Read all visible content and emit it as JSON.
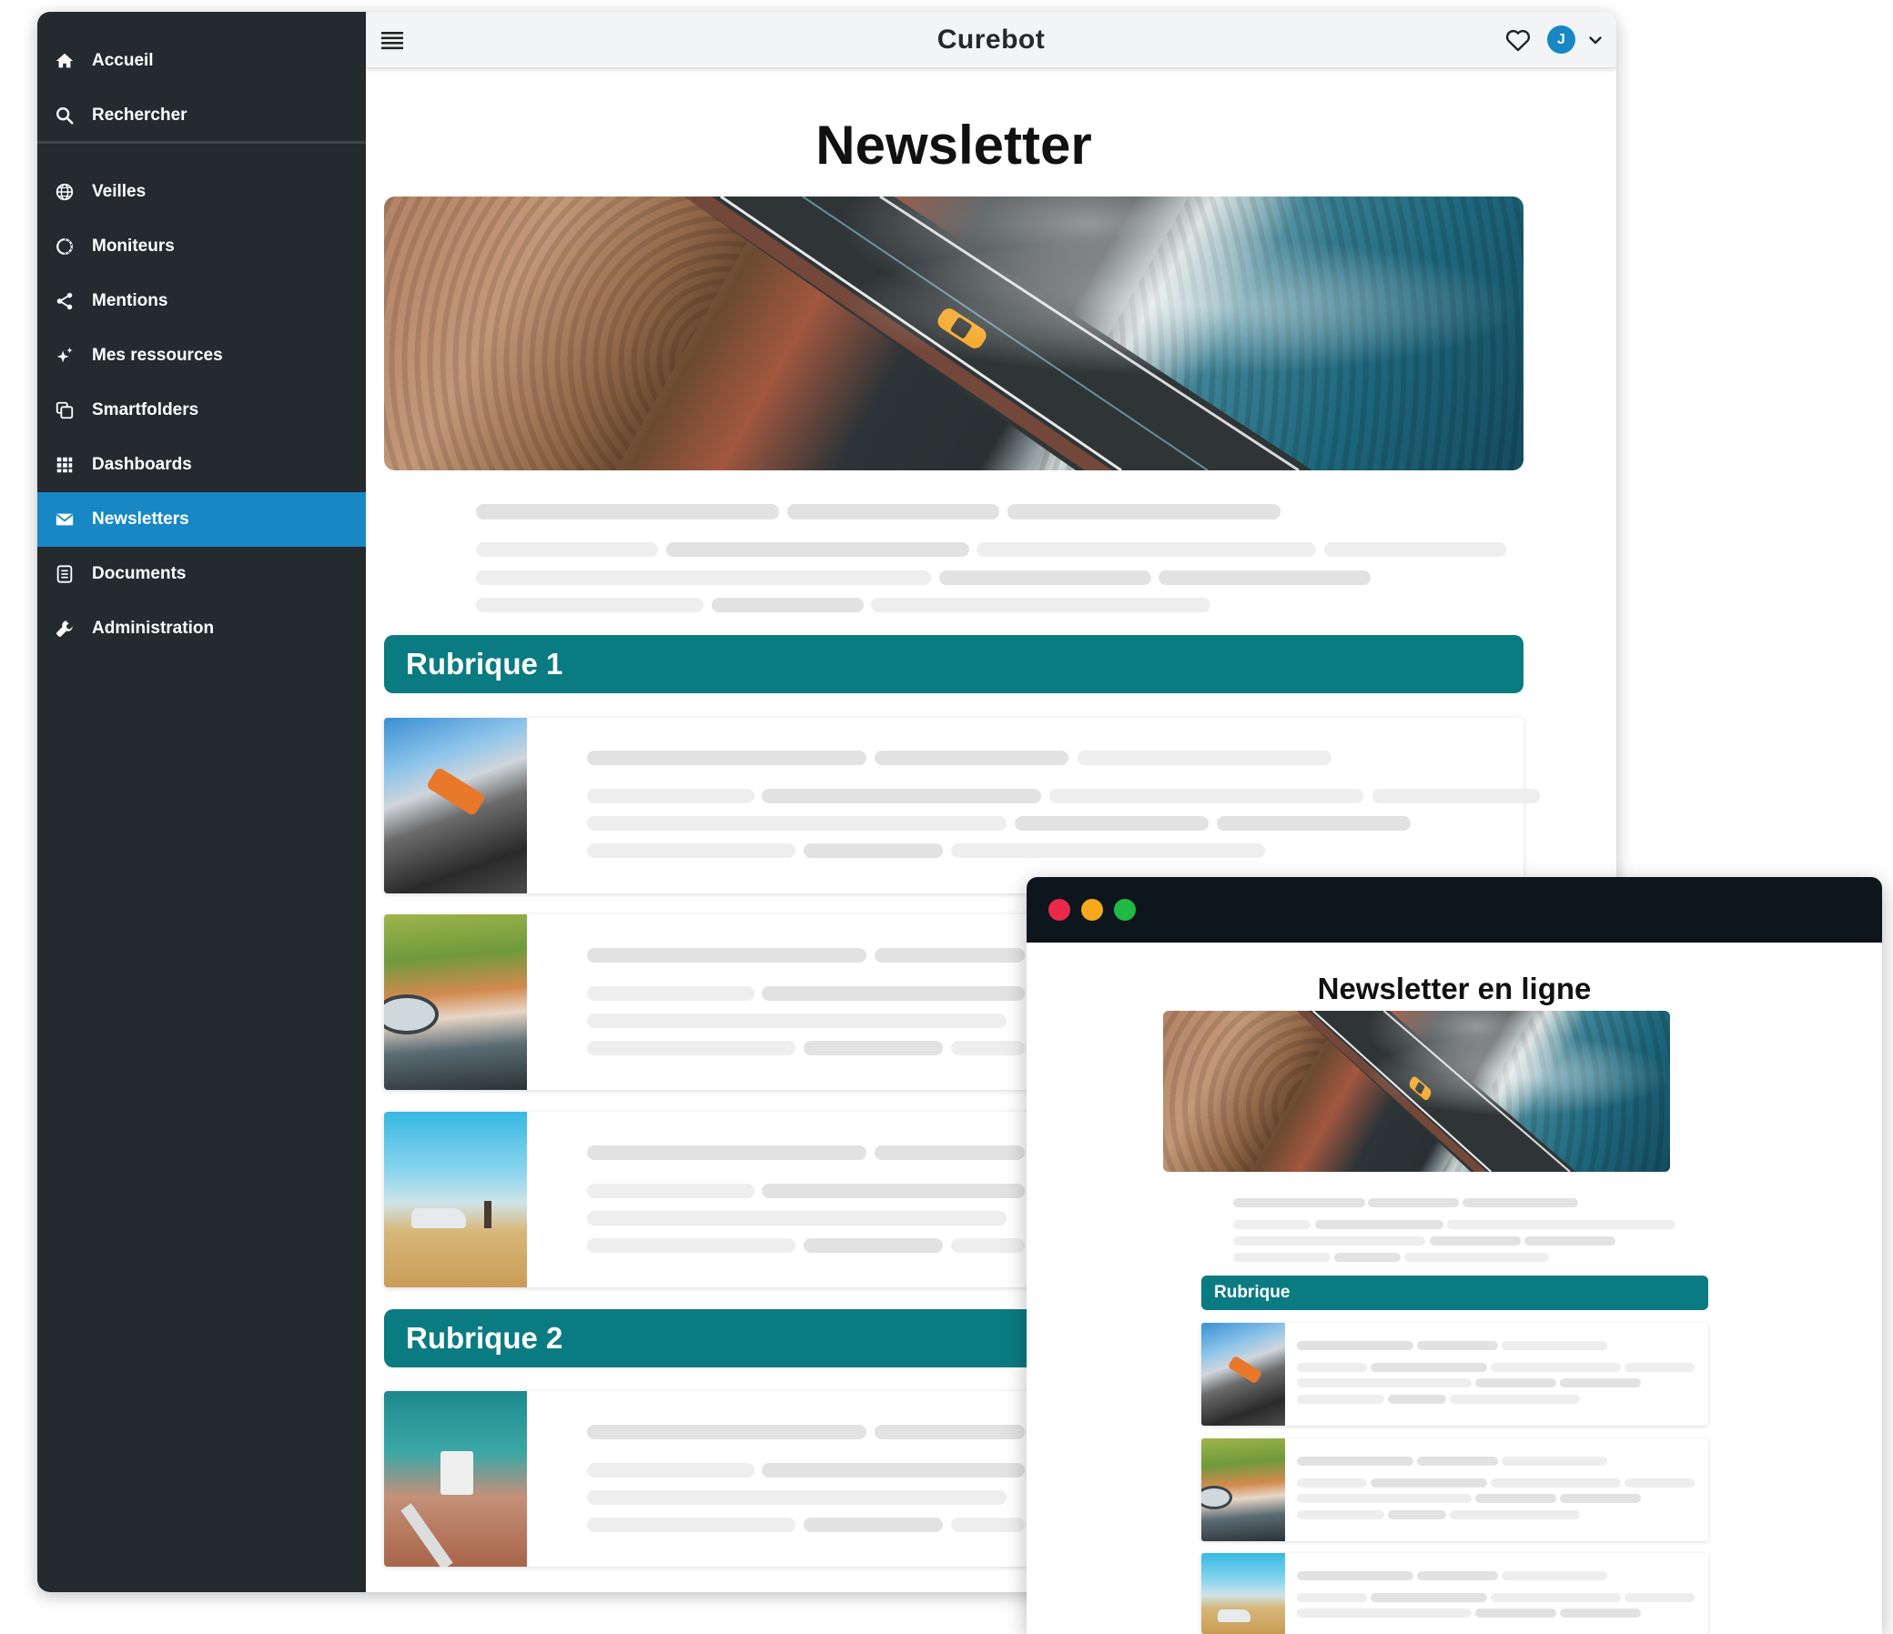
{
  "sidebar": {
    "items": [
      {
        "label": "Accueil",
        "icon": "home-icon"
      },
      {
        "label": "Rechercher",
        "icon": "search-icon"
      },
      {
        "label": "Veilles",
        "icon": "globe-icon"
      },
      {
        "label": "Moniteurs",
        "icon": "monitor-circle-icon"
      },
      {
        "label": "Mentions",
        "icon": "share-icon"
      },
      {
        "label": "Mes ressources",
        "icon": "sparkles-icon"
      },
      {
        "label": "Smartfolders",
        "icon": "folders-icon"
      },
      {
        "label": "Dashboards",
        "icon": "grid-icon"
      },
      {
        "label": "Newsletters",
        "icon": "envelope-icon",
        "active": true
      },
      {
        "label": "Documents",
        "icon": "document-icon"
      },
      {
        "label": "Administration",
        "icon": "wrench-icon"
      }
    ]
  },
  "header": {
    "brand": "Curebot",
    "avatar_initial": "J"
  },
  "newsletter": {
    "title": "Newsletter",
    "sections": [
      {
        "label": "Rubrique 1"
      },
      {
        "label": "Rubrique 2"
      }
    ]
  },
  "online_window": {
    "title": "Newsletter en ligne",
    "section_label": "Rubrique"
  },
  "colors": {
    "sidebar_bg": "#242a2e",
    "active_nav": "#1788c4",
    "rubrique": "#0b7b82",
    "window_bar": "#0c161c",
    "dot_red": "#e8294a",
    "dot_yellow": "#f5a91b",
    "dot_green": "#20b945"
  }
}
